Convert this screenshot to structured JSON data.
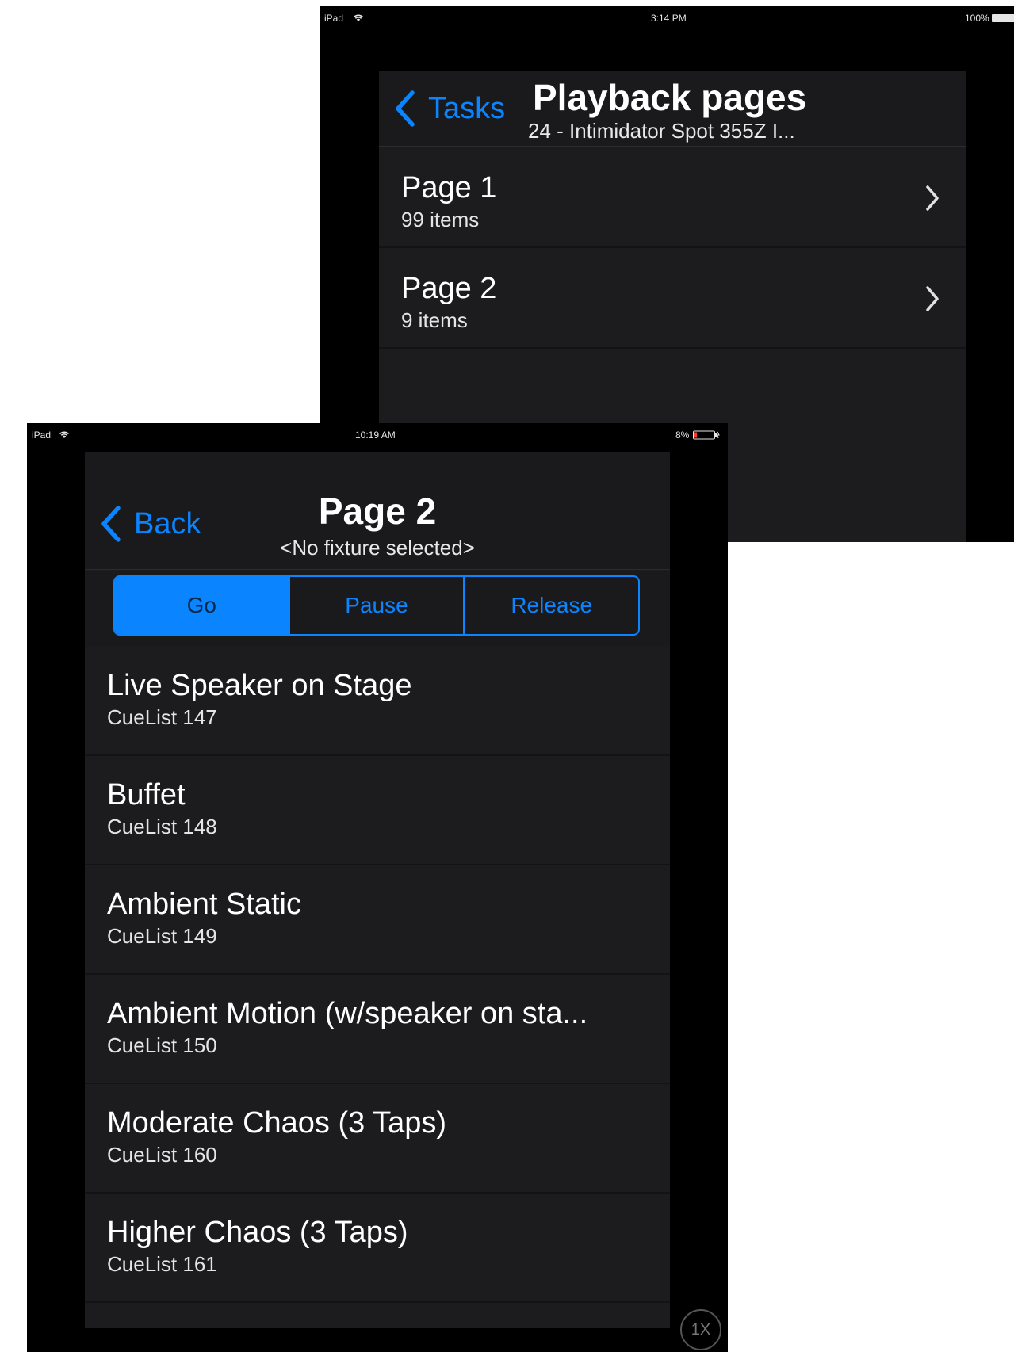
{
  "back_screen": {
    "status": {
      "device": "iPad",
      "time": "3:14 PM",
      "battery": "100%"
    },
    "nav": {
      "back_label": "Tasks",
      "title": "Playback pages",
      "subtitle": "24 - Intimidator Spot 355Z I..."
    },
    "pages": [
      {
        "title": "Page 1",
        "subtitle": "99 items"
      },
      {
        "title": "Page 2",
        "subtitle": "9 items"
      }
    ]
  },
  "front_screen": {
    "status": {
      "device": "iPad",
      "time": "10:19 AM",
      "battery": "8%"
    },
    "nav": {
      "back_label": "Back",
      "title": "Page 2",
      "subtitle": "<No fixture selected>"
    },
    "segments": {
      "go": "Go",
      "pause": "Pause",
      "release": "Release"
    },
    "cuelists": [
      {
        "title": "Live Speaker on Stage",
        "subtitle": "CueList 147"
      },
      {
        "title": "Buffet",
        "subtitle": "CueList 148"
      },
      {
        "title": "Ambient Static",
        "subtitle": "CueList 149"
      },
      {
        "title": "Ambient Motion (w/speaker on sta...",
        "subtitle": "CueList 150"
      },
      {
        "title": "Moderate Chaos (3 Taps)",
        "subtitle": "CueList 160"
      },
      {
        "title": "Higher Chaos (3 Taps)",
        "subtitle": "CueList 161"
      }
    ],
    "zoom_label": "1X"
  },
  "colors": {
    "accent": "#0a84ff",
    "background": "#000000",
    "cell": "#1c1c1e"
  },
  "icons": {
    "wifi": "wifi-icon",
    "battery": "battery-icon",
    "back": "chevron-left-icon",
    "disclosure": "chevron-right-icon"
  }
}
